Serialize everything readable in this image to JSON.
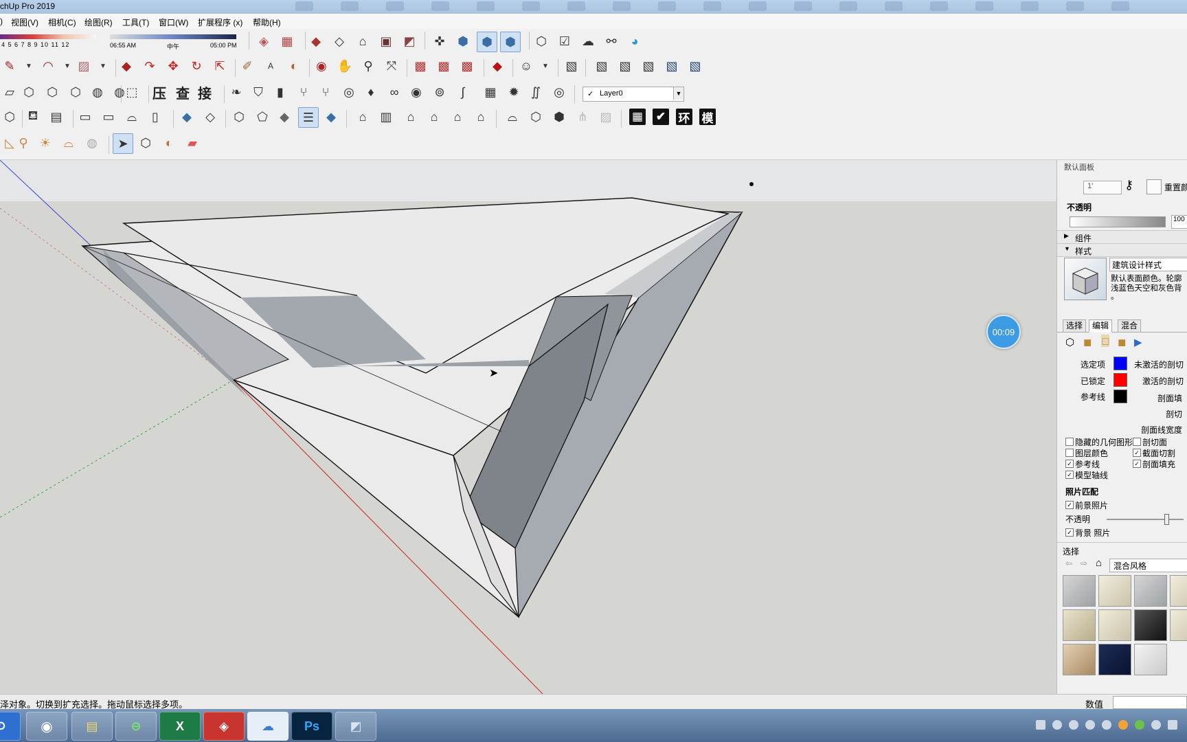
{
  "window": {
    "title": "chUp Pro 2019"
  },
  "menu": [
    "视图(V)",
    "相机(C)",
    "绘图(R)",
    "工具(T)",
    "窗口(W)",
    "扩展程序 (x)",
    "帮助(H)"
  ],
  "shadow": {
    "months": "4  5  6  7  8  9  10 11 12",
    "time_start": "06:55 AM",
    "time_mid": "中午",
    "time_end": "05:00 PM"
  },
  "toolbar": {
    "cjk_buttons": [
      "压",
      "查",
      "接"
    ],
    "dark_buttons": [
      "环",
      "模"
    ],
    "layer": {
      "name": "Layer0"
    }
  },
  "viewport": {
    "timer": "00:09"
  },
  "tray": {
    "title": "默认面板",
    "ghost_value": "1'",
    "reset_label": "重置颜",
    "opacity_label": "不透明",
    "opacity_value": "100",
    "section_components": "组件",
    "section_styles": "样式",
    "style": {
      "name": "建筑设计样式",
      "description_line1": "默认表面颜色。轮廓",
      "description_line2": "浅蓝色天空和灰色背",
      "description_line3": "。"
    },
    "tabs": [
      "选择",
      "编辑",
      "混合"
    ],
    "colors": {
      "selected_label": "选定项",
      "selected_color": "#0000ff",
      "inactive_cut_label": "未激活的剖切",
      "locked_label": "已锁定",
      "locked_color": "#ff0000",
      "active_cut_label": "激活的剖切",
      "guide_label": "参考线",
      "guide_color": "#000000",
      "section_fill_label": "剖面填",
      "section_line_label": "剖切",
      "section_width_label": "剖面线宽度"
    },
    "checkboxes": [
      {
        "label": "隐藏的几何图形",
        "checked": false
      },
      {
        "label": "剖切面",
        "checked": false
      },
      {
        "label": "图层颜色",
        "checked": false
      },
      {
        "label": "截面切割",
        "checked": true
      },
      {
        "label": "参考线",
        "checked": true
      },
      {
        "label": "剖面填充",
        "checked": true
      },
      {
        "label": "模型轴线",
        "checked": true
      }
    ],
    "photo_match": {
      "title": "照片匹配",
      "foreground": "前景照片",
      "opacity": "不透明",
      "background": "背景 照片"
    },
    "select_section": {
      "title": "选择",
      "library": "混合风格"
    }
  },
  "status": {
    "message": "泽对象。切换到扩充选择。拖动鼠标选择多项。",
    "value_label": "数值"
  }
}
